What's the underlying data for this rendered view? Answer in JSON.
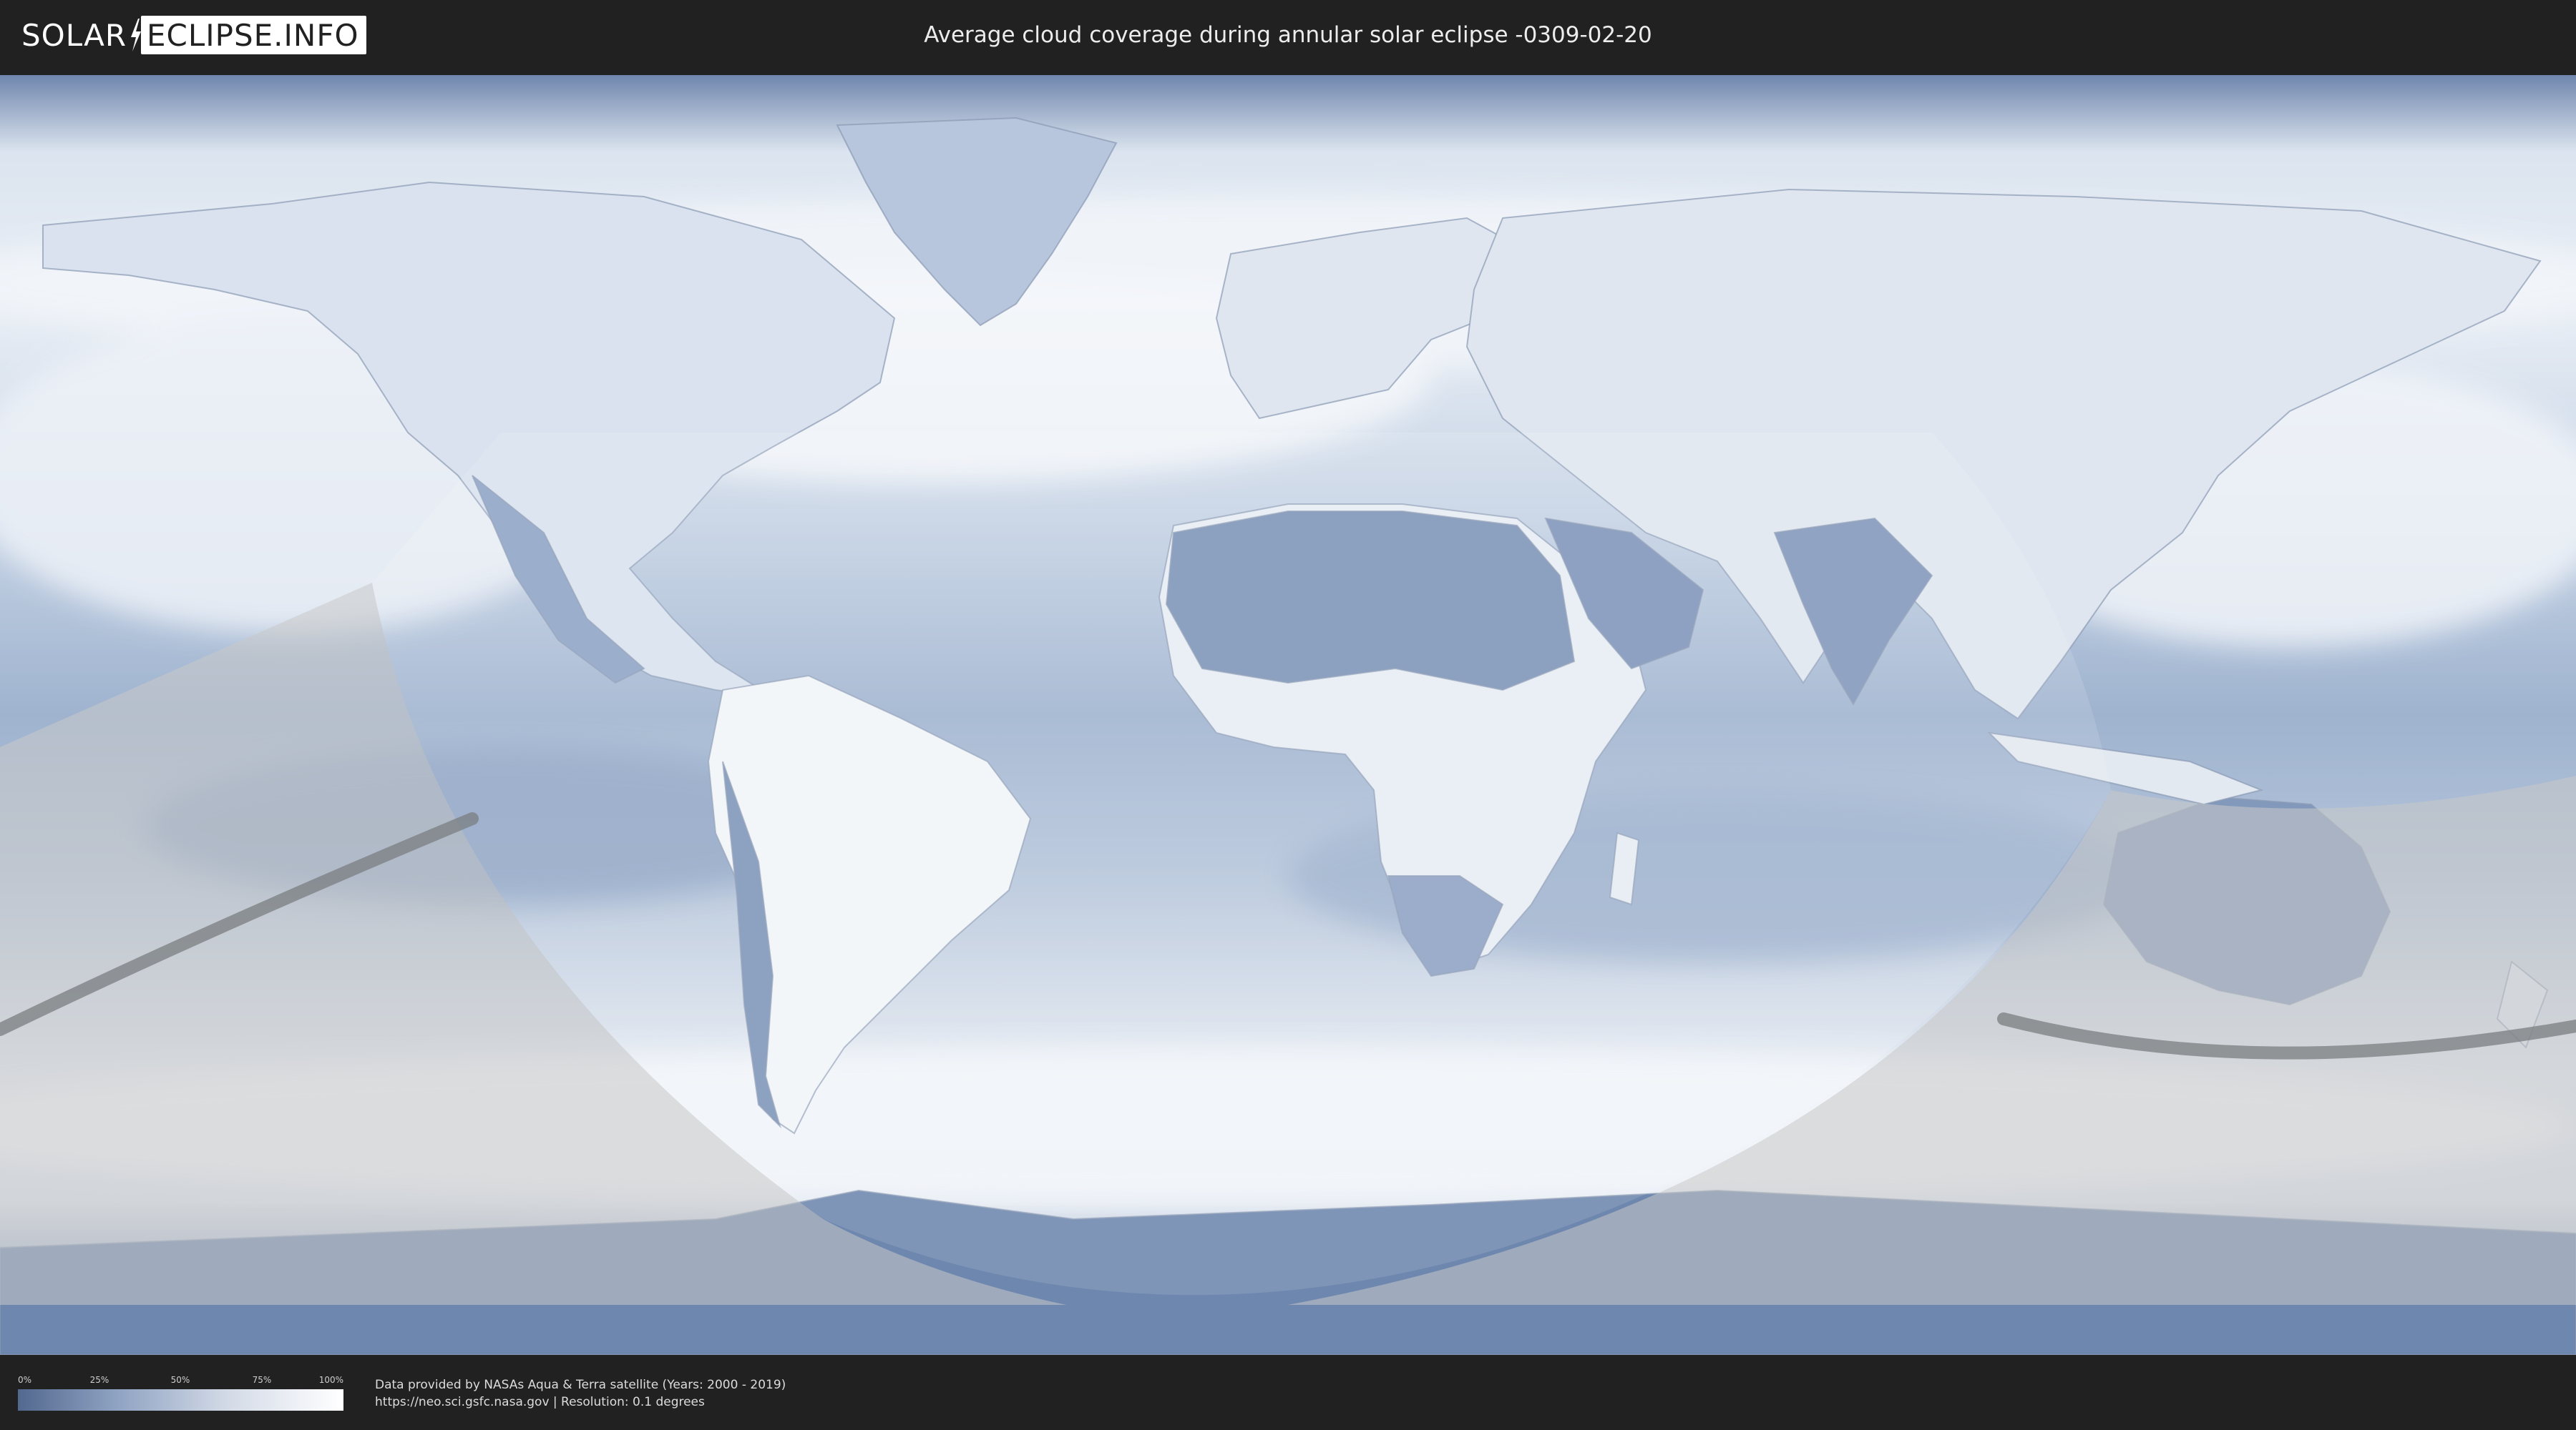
{
  "header": {
    "logo_left": "SOLAR",
    "logo_right": "ECLIPSE.INFO",
    "title": "Average cloud coverage during annular solar eclipse -0309-02-20"
  },
  "legend": {
    "ticks": [
      "0%",
      "25%",
      "50%",
      "75%",
      "100%"
    ],
    "colors": {
      "low": "#53688f",
      "high": "#ffffff"
    }
  },
  "credits": {
    "line1": "Data provided by NASAs Aqua & Terra satellite (Years: 2000 - 2019)",
    "line2": "https://neo.sci.gsfc.nasa.gov | Resolution: 0.1 degrees"
  },
  "colors": {
    "background": "#212121",
    "clear_sky": "#5b76a3",
    "cloud": "#f4f7fb",
    "night_overlay": "#c9c9c9",
    "eclipse_path": "#7a7d80"
  }
}
